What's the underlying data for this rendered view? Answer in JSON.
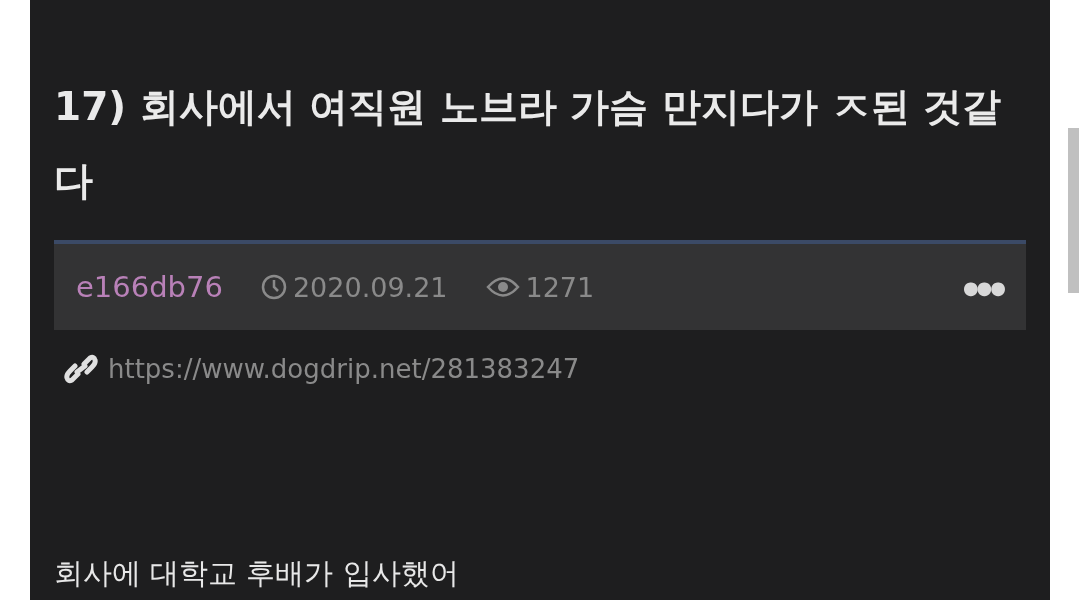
{
  "post": {
    "title": "17) 회사에서 여직원 노브라 가슴 만지다가 ㅈ된 것같다",
    "author": "e166db76",
    "date": "2020.09.21",
    "views": "1271",
    "more": "●●●",
    "url": "https://www.dogdrip.net/281383247",
    "body": "회사에 대학교 후배가 입사했어"
  }
}
